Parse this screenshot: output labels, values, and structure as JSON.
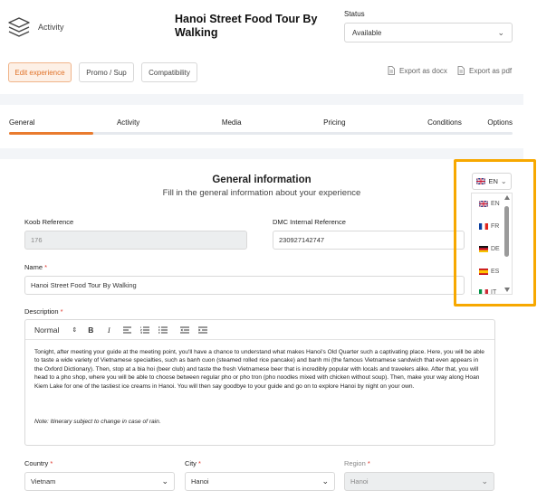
{
  "header": {
    "app_label": "Activity",
    "tour_title": "Hanoi Street Food Tour By Walking",
    "status_label": "Status",
    "status_value": "Available"
  },
  "actions": {
    "tabs": [
      "Edit experience",
      "Promo / Sup",
      "Compatibility"
    ],
    "export_docx": "Export as docx",
    "export_pdf": "Export as pdf"
  },
  "sections": {
    "items": [
      "General",
      "Activity",
      "Media",
      "Pricing",
      "Conditions",
      "Options"
    ],
    "progress_fraction": 0.167
  },
  "general": {
    "title": "General information",
    "subtitle": "Fill in the general information about your experience",
    "koob_label": "Koob Reference",
    "koob_value": "176",
    "dmc_label": "DMC Internal Reference",
    "dmc_value": "230927142747",
    "name_label": "Name",
    "name_value": "Hanoi Street Food Tour By Walking",
    "description_label": "Description",
    "editor_format": "Normal",
    "description_text": "Tonight, after meeting your guide at the meeting point, you'll have a chance to understand what makes Hanoi's Old Quarter such a captivating place. Here, you will be able to taste a wide variety of Vietnamese specialties, such as banh cuon (steamed rolled rice pancake) and banh mi (the famous Vietnamese sandwich that even appears in the Oxford Dictionary). Then, stop at a bia hoi (beer club) and taste the fresh Vietnamese beer that is incredibly popular with locals and travelers alike. After that, you will head to a pho shop, where you will be able to choose between regular pho or pho tron (pho noodles mixed with chicken without soup). Then, make your way along Hoan Kiem Lake for one of the tastiest ice creams in Hanoi. You will then say goodbye to your guide and go on to explore Hanoi by night on your own.",
    "description_note": "Note: Itinerary subject to change in case of rain.",
    "country_label": "Country",
    "country_value": "Vietnam",
    "city_label": "City",
    "city_value": "Hanoi",
    "region_label": "Region",
    "region_value": "Hanoi",
    "required_mark": "*"
  },
  "language": {
    "current": "EN",
    "options": [
      "EN",
      "FR",
      "DE",
      "ES",
      "IT"
    ],
    "highlight_color": "#f7a800"
  },
  "colors": {
    "accent": "#e97b2e"
  }
}
